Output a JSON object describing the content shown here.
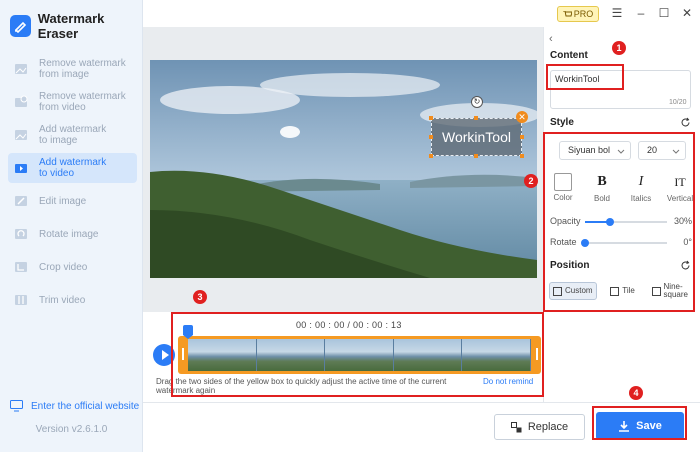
{
  "app": {
    "title": "Watermark Eraser",
    "version": "Version v2.6.1.0",
    "official_site": "Enter the official website"
  },
  "titlebar": {
    "pro_label": "PRO"
  },
  "sidebar": {
    "items": [
      {
        "label": "Remove watermark\nfrom image",
        "icon": "image-erase-icon",
        "active": false
      },
      {
        "label": "Remove watermark\nfrom video",
        "icon": "video-erase-icon",
        "active": false
      },
      {
        "label": "Add watermark\nto image",
        "icon": "image-add-icon",
        "active": false
      },
      {
        "label": "Add watermark\nto video",
        "icon": "video-add-icon",
        "active": true
      },
      {
        "label": "Edit image",
        "icon": "edit-image-icon",
        "active": false
      },
      {
        "label": "Rotate image",
        "icon": "rotate-image-icon",
        "active": false
      },
      {
        "label": "Crop video",
        "icon": "crop-video-icon",
        "active": false
      },
      {
        "label": "Trim video",
        "icon": "trim-video-icon",
        "active": false
      }
    ]
  },
  "preview": {
    "watermark_text": "WorkinTool"
  },
  "timeline": {
    "timecode": "00 : 00 : 00 / 00 : 00 : 13",
    "hint": "Drag the two sides of the yellow box to quickly adjust the active time of the current watermark again",
    "remind_label": "Do not remind"
  },
  "panel": {
    "content_title": "Content",
    "content_value": "WorkinTool",
    "content_counter": "10/20",
    "style_title": "Style",
    "font_family": "Siyuan bol",
    "font_size": "20",
    "style_buttons": [
      {
        "label": "Color",
        "glyph": ""
      },
      {
        "label": "Bold",
        "glyph": "B"
      },
      {
        "label": "Italics",
        "glyph": "I"
      },
      {
        "label": "Vertical",
        "glyph": "IT"
      }
    ],
    "opacity": {
      "label": "Opacity",
      "value_text": "30%",
      "value": 0.3
    },
    "rotate": {
      "label": "Rotate",
      "value_text": "0°",
      "value": 0.0
    },
    "position_title": "Position",
    "position_options": [
      {
        "label": "Custom",
        "active": true
      },
      {
        "label": "Tile",
        "active": false
      },
      {
        "label": "Nine-\nsquare",
        "active": false
      }
    ]
  },
  "actions": {
    "replace_label": "Replace",
    "save_label": "Save"
  },
  "annotations": [
    "1",
    "2",
    "3",
    "4"
  ],
  "colors": {
    "accent": "#2b7cf6",
    "highlight": "#f59a23",
    "annotation": "#e02020",
    "sidebar_bg": "#eef4fb"
  }
}
